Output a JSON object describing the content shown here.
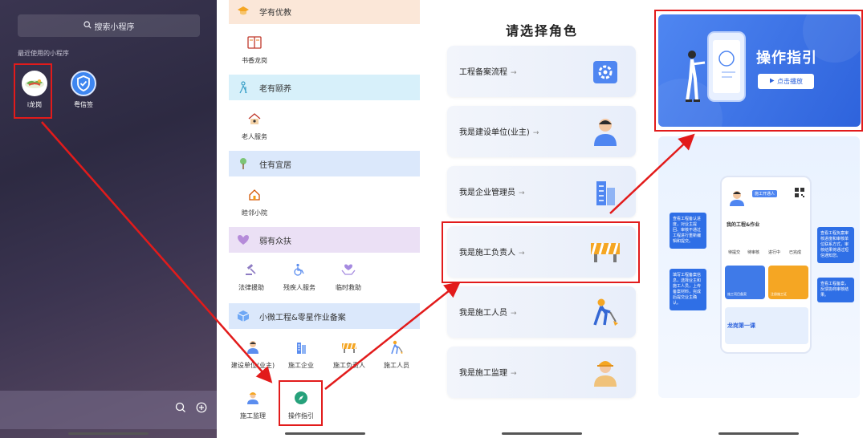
{
  "panel1": {
    "search_text": "搜索小程序",
    "recent_label": "最近使用的小程序",
    "apps": [
      {
        "label": "i龙岗",
        "icon": "ilonggang-app-icon"
      },
      {
        "label": "粤信签",
        "icon": "shield-check-app-icon"
      }
    ]
  },
  "panel2": {
    "sections": [
      {
        "label": "学有优教",
        "color": "#fbe7d8"
      },
      {
        "label": "老有颐养",
        "color": "#d7f0fa"
      },
      {
        "label": "住有宜居",
        "color": "#dbe8fb"
      },
      {
        "label": "弱有众扶",
        "color": "#ebe0f5"
      },
      {
        "label": "小微工程&零星作业备案",
        "color": "#dbe8fb"
      }
    ],
    "items": {
      "book": "书香龙岗",
      "elder": "老人服务",
      "home": "睦邻小院",
      "legal": "法律援助",
      "disabled": "残疾人服务",
      "relief": "临时救助",
      "builder": "建设单位(业主)",
      "company": "施工企业",
      "leader": "施工负责人",
      "worker": "施工人员",
      "supervisor": "施工监理",
      "guide": "操作指引"
    }
  },
  "panel3": {
    "title": "请选择角色",
    "cards": [
      {
        "label": "工程备案流程",
        "icon": "process-gear-icon"
      },
      {
        "label": "我是建设单位(业主)",
        "icon": "person-icon"
      },
      {
        "label": "我是企业管理员",
        "icon": "building-icon"
      },
      {
        "label": "我是施工负责人",
        "icon": "barrier-icon"
      },
      {
        "label": "我是施工人员",
        "icon": "worker-shovel-icon"
      },
      {
        "label": "我是施工监理",
        "icon": "hardhat-person-icon"
      }
    ],
    "arrow": "→"
  },
  "panel4": {
    "banner_title": "操作指引",
    "banner_play": "点击播放",
    "phone": {
      "badge": "施工开通人",
      "section_title": "我的工程&作业",
      "tile_a": "施工项目备案",
      "tile_b": "注册施工证",
      "course": "龙岗第一课",
      "stats": [
        "待提交",
        "待审核",
        "进行中",
        "已完成"
      ]
    },
    "bubbles": {
      "left_top": "查看工程备认进度，对业主提回、审核不通过工程进行重新编辑和提交。",
      "left_bottom": "填写工程备案信息，选择业主和施工人员，上传备案材料，完成后提交业主确认。",
      "right_top": "查看工程负案审核进度和审核单位联系方式，审核结果将通过短信通知您。",
      "right_bottom": "查看工程备案，反馈协商审核结果。"
    }
  },
  "colors": {
    "highlight": "#e21b1b",
    "brand_blue": "#2e63dc"
  }
}
